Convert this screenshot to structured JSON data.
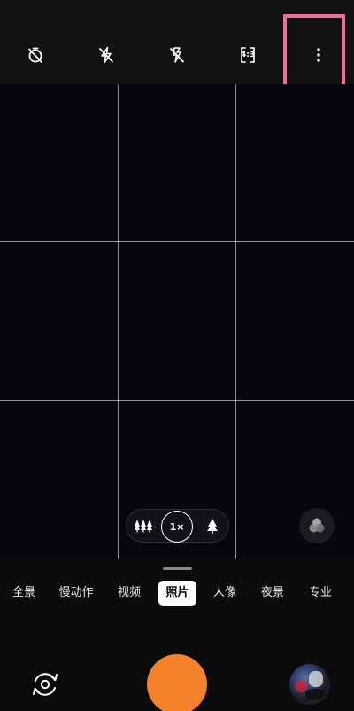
{
  "toolbar": {
    "icons": [
      "timer-off-icon",
      "flash-off-icon",
      "live-photo-off-icon",
      "aspect-ratio-icon",
      "more-options-icon"
    ],
    "aspect_ratio": "4:3"
  },
  "viewfinder": {
    "zoom": {
      "current": "1×",
      "wide_icon": "wide-angle-trees-icon",
      "tele_icon": "telephoto-tree-icon"
    },
    "filter_icon": "filter-icon"
  },
  "modes": {
    "items": [
      "全景",
      "慢动作",
      "视频",
      "照片",
      "人像",
      "夜景",
      "专业"
    ],
    "active": "照片"
  },
  "bottom": {
    "switch_icon": "switch-camera-icon",
    "shutter_color": "#f4812c",
    "gallery_icon": "gallery-thumbnail"
  },
  "colors": {
    "highlight": "#e8709a",
    "shutter": "#f4812c"
  }
}
